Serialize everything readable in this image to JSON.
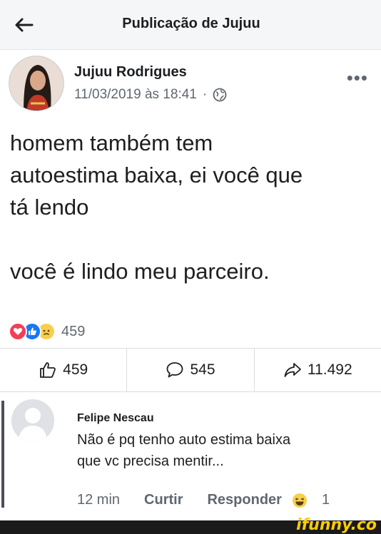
{
  "header": {
    "title": "Publicação de Jujuu",
    "back_icon": "arrow-left-icon"
  },
  "post": {
    "author": "Jujuu Rodrigues",
    "date": "11/03/2019 às 18:41",
    "separator": "·",
    "privacy_icon": "globe-icon",
    "more_icon": "•••",
    "text": "homem também tem\nautoestima baixa, ei você que\ntá lendo\n\nvocê é lindo meu parceiro."
  },
  "reactions": {
    "icons": [
      "love-icon",
      "like-icon",
      "sad-icon"
    ],
    "count": "459"
  },
  "actions": {
    "like_count": "459",
    "comment_count": "545",
    "share_count": "11.492"
  },
  "comment": {
    "author": "Felipe Nescau",
    "text": "Não é pq tenho auto estima baixa\nque vc precisa mentir...",
    "time": "12 min",
    "like_label": "Curtir",
    "reply_label": "Responder",
    "reaction_icon": "laugh-icon",
    "reaction_count": "1"
  },
  "watermark": "ifunny.co",
  "colors": {
    "brand_blue": "#1877f2",
    "love_red": "#f33e58",
    "sad_yellow": "#f7cf4b",
    "text_secondary": "#606770"
  }
}
